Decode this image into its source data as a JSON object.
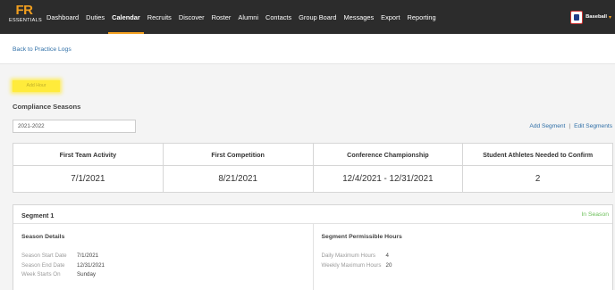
{
  "brand": {
    "logo_main": "FR",
    "logo_sub": "ESSENTIALS"
  },
  "nav": {
    "items": [
      {
        "label": "Dashboard"
      },
      {
        "label": "Duties"
      },
      {
        "label": "Calendar",
        "active": true
      },
      {
        "label": "Recruits"
      },
      {
        "label": "Discover"
      },
      {
        "label": "Roster"
      },
      {
        "label": "Alumni"
      },
      {
        "label": "Contacts"
      },
      {
        "label": "Group Board"
      },
      {
        "label": "Messages"
      },
      {
        "label": "Export"
      },
      {
        "label": "Reporting"
      }
    ],
    "team_name": "Baseball",
    "team_icon": "team-logo-icon",
    "caret_icon": "chevron-down-icon"
  },
  "back_link": "Back to Practice Logs",
  "add_button": "Add Hour",
  "compliance": {
    "title": "Compliance Seasons",
    "season_selected": "2021-2022",
    "add_segment": "Add Segment",
    "separator": "|",
    "edit_segments": "Edit Segments",
    "columns": [
      {
        "header": "First Team Activity",
        "value": "7/1/2021"
      },
      {
        "header": "First Competition",
        "value": "8/21/2021"
      },
      {
        "header": "Conference Championship",
        "value": "12/4/2021 - 12/31/2021"
      },
      {
        "header": "Student Athletes Needed to Confirm",
        "value": "2"
      }
    ]
  },
  "segment": {
    "title": "Segment 1",
    "status": "In Season",
    "details_title": "Season Details",
    "details": [
      {
        "label": "Season Start Date",
        "value": "7/1/2021"
      },
      {
        "label": "Season End Date",
        "value": "12/31/2021"
      },
      {
        "label": "Week Starts On",
        "value": "Sunday"
      }
    ],
    "hours_title": "Segment Permissible Hours",
    "hours": [
      {
        "label": "Daily Maximum Hours",
        "value": "4"
      },
      {
        "label": "Weekly Maximum Hours",
        "value": "20"
      }
    ]
  },
  "colors": {
    "accent": "#f29f1f",
    "nav_bg": "#2c2c2c",
    "link": "#2f6fa7",
    "status_green": "#6bbf59",
    "highlight": "#ffeb3b"
  }
}
